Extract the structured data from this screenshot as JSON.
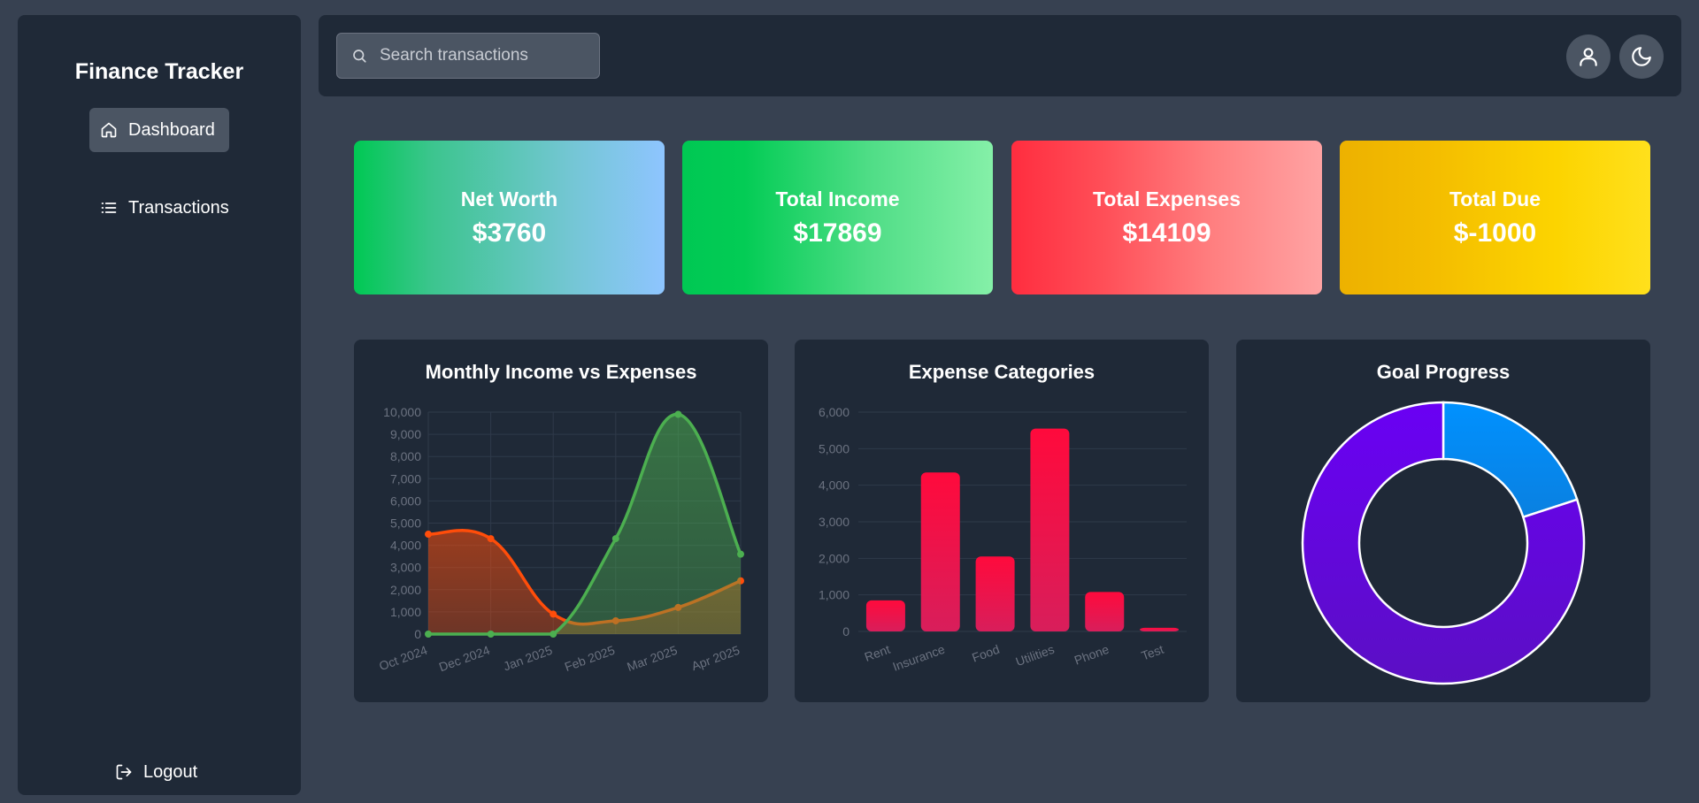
{
  "app": {
    "title": "Finance Tracker"
  },
  "sidebar": {
    "items": [
      {
        "label": "Dashboard",
        "icon": "home-icon",
        "active": true
      },
      {
        "label": "Transactions",
        "icon": "list-icon",
        "active": false
      }
    ],
    "logout_label": "Logout"
  },
  "search": {
    "placeholder": "Search transactions",
    "value": ""
  },
  "header": {
    "user_icon": "user-icon",
    "theme_icon": "moon-icon"
  },
  "stats": [
    {
      "label": "Net Worth",
      "value": "$3760"
    },
    {
      "label": "Total Income",
      "value": "$17869"
    },
    {
      "label": "Total Expenses",
      "value": "$14109"
    },
    {
      "label": "Total Due",
      "value": "$-1000"
    }
  ],
  "chart_data": [
    {
      "type": "area",
      "title": "Monthly Income vs Expenses",
      "categories": [
        "Oct 2024",
        "Dec 2024",
        "Jan 2025",
        "Feb 2025",
        "Mar 2025",
        "Apr 2025"
      ],
      "ylim": [
        0,
        10000
      ],
      "yticks": [
        0,
        1000,
        2000,
        3000,
        4000,
        5000,
        6000,
        7000,
        8000,
        9000,
        10000
      ],
      "grid": true,
      "series": [
        {
          "values": [
            4500,
            4300,
            900,
            600,
            1200,
            2400
          ],
          "color": "#ff4d0a"
        },
        {
          "values": [
            0,
            0,
            0,
            4300,
            9900,
            3600
          ],
          "color": "#4caf50"
        }
      ]
    },
    {
      "type": "bar",
      "title": "Expense Categories",
      "categories": [
        "Rent",
        "Insurance",
        "Food",
        "Utilities",
        "Phone",
        "Test"
      ],
      "values": [
        850,
        4350,
        2050,
        5550,
        1080,
        100
      ],
      "ylim": [
        0,
        6000
      ],
      "yticks": [
        0,
        1000,
        2000,
        3000,
        4000,
        5000,
        6000
      ],
      "grid": true,
      "color_top": "#ff0a3c",
      "color_bottom": "#d81e5b"
    },
    {
      "type": "pie",
      "title": "Goal Progress",
      "values": [
        20,
        80
      ],
      "colors": [
        "#0091ff",
        "#6a00f4"
      ]
    }
  ]
}
